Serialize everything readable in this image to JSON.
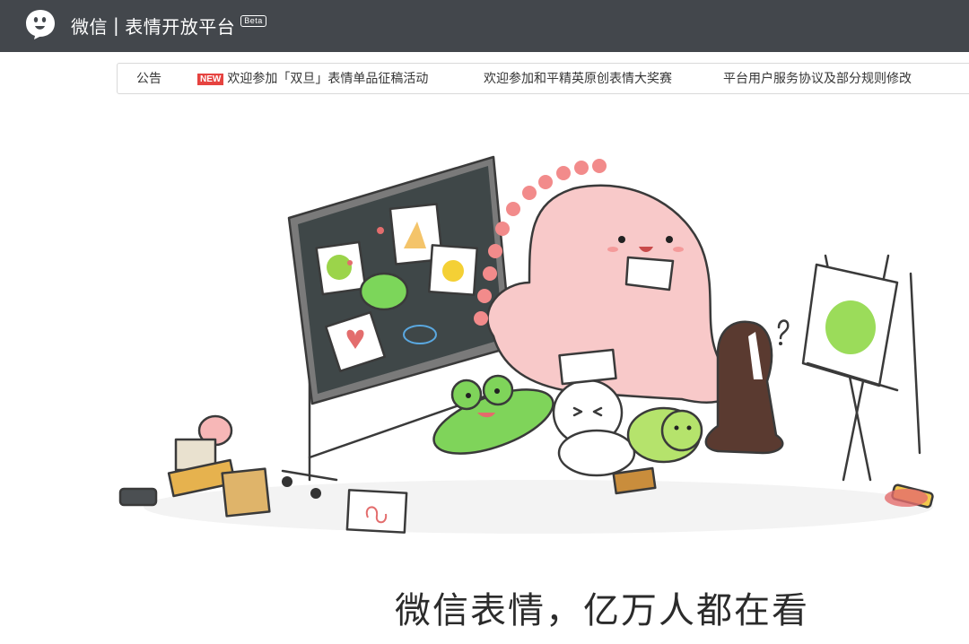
{
  "header": {
    "logo_icon": "wechat-emoji-logo-icon",
    "app_name": "微信",
    "separator": "|",
    "platform_name": "表情开放平台",
    "beta_label": "Beta",
    "bar_color": "#43474c"
  },
  "notice_bar": {
    "title": "公告",
    "new_badge": "NEW",
    "new_badge_color": "#e64340",
    "items": [
      "欢迎参加「双旦」表情单品征稿活动",
      "欢迎参加和平精英原创表情大奖赛",
      "平台用户服务协议及部分规则修改"
    ]
  },
  "hero": {
    "illustration": "sticker-characters-drawing-illustration",
    "headline": "微信表情，亿万人都在看"
  }
}
